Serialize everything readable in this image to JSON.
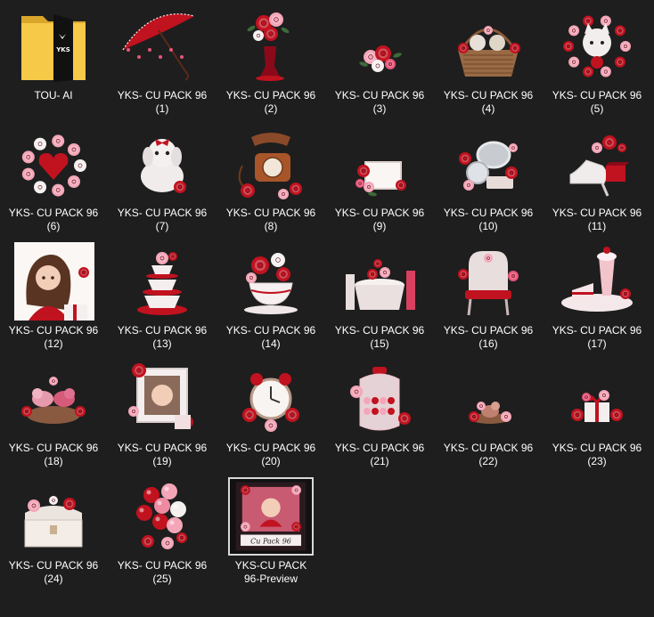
{
  "window": {
    "background": "#1e1e1e"
  },
  "files": [
    {
      "name": "TOU- AI",
      "type": "folder",
      "icon": "folder-icon",
      "folder_badge": "YKS"
    },
    {
      "name": "YKS- CU PACK 96\n(1)",
      "type": "image",
      "icon": "red-lace-umbrella-icon",
      "theme": "umbrella"
    },
    {
      "name": "YKS- CU PACK 96\n(2)",
      "type": "image",
      "icon": "flower-vase-icon",
      "theme": "vase"
    },
    {
      "name": "YKS- CU PACK 96\n(3)",
      "type": "image",
      "icon": "flower-cluster-icon",
      "theme": "cluster-small"
    },
    {
      "name": "YKS- CU PACK 96\n(4)",
      "type": "image",
      "icon": "kittens-basket-icon",
      "theme": "basket"
    },
    {
      "name": "YKS- CU PACK 96\n(5)",
      "type": "image",
      "icon": "kitten-wreath-icon",
      "theme": "kitten"
    },
    {
      "name": "YKS- CU PACK 96\n(6)",
      "type": "image",
      "icon": "heart-bouquet-icon",
      "theme": "heart"
    },
    {
      "name": "YKS- CU PACK 96\n(7)",
      "type": "image",
      "icon": "white-puppy-icon",
      "theme": "puppy"
    },
    {
      "name": "YKS- CU PACK 96\n(8)",
      "type": "image",
      "icon": "vintage-phone-icon",
      "theme": "phone"
    },
    {
      "name": "YKS- CU PACK 96\n(9)",
      "type": "image",
      "icon": "floral-frame-icon",
      "theme": "frame-small"
    },
    {
      "name": "YKS- CU PACK 96\n(10)",
      "type": "image",
      "icon": "mirror-compact-icon",
      "theme": "mirror"
    },
    {
      "name": "YKS- CU PACK 96\n(11)",
      "type": "image",
      "icon": "high-heel-shoes-icon",
      "theme": "shoes"
    },
    {
      "name": "YKS- CU PACK 96\n(12)",
      "type": "image",
      "icon": "girl-portrait-icon",
      "theme": "girl"
    },
    {
      "name": "YKS- CU PACK 96\n(13)",
      "type": "image",
      "icon": "teacup-stack-icon",
      "theme": "teacups"
    },
    {
      "name": "YKS- CU PACK 96\n(14)",
      "type": "image",
      "icon": "rose-teacup-icon",
      "theme": "teacup"
    },
    {
      "name": "YKS- CU PACK 96\n(15)",
      "type": "image",
      "icon": "tea-table-icon",
      "theme": "table"
    },
    {
      "name": "YKS- CU PACK 96\n(16)",
      "type": "image",
      "icon": "vanity-chair-icon",
      "theme": "chair"
    },
    {
      "name": "YKS- CU PACK 96\n(17)",
      "type": "image",
      "icon": "milkshake-cake-icon",
      "theme": "dessert"
    },
    {
      "name": "YKS- CU PACK 96\n(18)",
      "type": "image",
      "icon": "love-birds-nest-icon",
      "theme": "birds"
    },
    {
      "name": "YKS- CU PACK 96\n(19)",
      "type": "image",
      "icon": "baby-photo-frame-icon",
      "theme": "photo"
    },
    {
      "name": "YKS- CU PACK 96\n(20)",
      "type": "image",
      "icon": "alarm-clock-icon",
      "theme": "clock"
    },
    {
      "name": "YKS- CU PACK 96\n(21)",
      "type": "image",
      "icon": "candy-jar-icon",
      "theme": "jar"
    },
    {
      "name": "YKS- CU PACK 96\n(22)",
      "type": "image",
      "icon": "bird-flowers-icon",
      "theme": "bird-small"
    },
    {
      "name": "YKS- CU PACK 96\n(23)",
      "type": "image",
      "icon": "gift-box-icon",
      "theme": "gift"
    },
    {
      "name": "YKS- CU PACK 96\n(24)",
      "type": "image",
      "icon": "treasure-chest-icon",
      "theme": "chest"
    },
    {
      "name": "YKS- CU PACK 96\n(25)",
      "type": "image",
      "icon": "balloons-bouquet-icon",
      "theme": "balloons"
    },
    {
      "name": "YKS-CU PACK\n96-Preview",
      "type": "preview",
      "icon": "preview-collage-icon",
      "theme": "preview",
      "preview_script": "Cu Pack 96"
    }
  ],
  "colors": {
    "folder_yellow": "#f7c948",
    "folder_dark": "#d9a62b",
    "crimson": "#c1121f",
    "deep_red": "#8b0a1a",
    "rose": "#e8557a",
    "pink": "#f4a6b8",
    "white": "#f5f0f0",
    "caption": "#ffffff"
  }
}
